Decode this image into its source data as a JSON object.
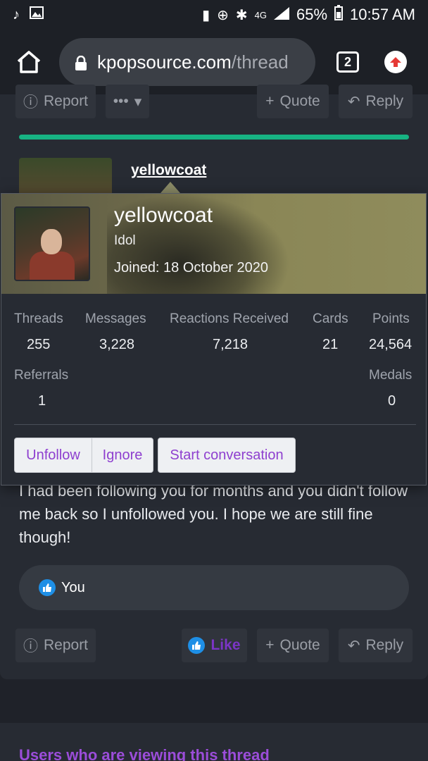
{
  "status_bar": {
    "battery": "65%",
    "time": "10:57 AM",
    "network": "4G"
  },
  "browser": {
    "host": "kpopsource.com",
    "path": "/thread",
    "tab_count": "2"
  },
  "post_actions_top": {
    "report": "Report",
    "more": "•••",
    "quote": "Quote",
    "reply": "Reply"
  },
  "post": {
    "author": "yellowcoat",
    "message": "I had been following you for months and you didn't follow me back so I unfollowed you. I hope we are still fine though!",
    "reaction_user": "You",
    "actions": {
      "report": "Report",
      "like": "Like",
      "quote": "Quote",
      "reply": "Reply"
    }
  },
  "popup": {
    "username": "yellowcoat",
    "user_title": "Idol",
    "joined": "Joined: 18 October 2020",
    "stats": [
      {
        "label": "Threads",
        "value": "255"
      },
      {
        "label": "Messages",
        "value": "3,228"
      },
      {
        "label": "Reactions Received",
        "value": "7,218"
      },
      {
        "label": "Cards",
        "value": "21"
      },
      {
        "label": "Points",
        "value": "24,564"
      },
      {
        "label": "Referrals",
        "value": "1"
      },
      {
        "label": "Medals",
        "value": "0"
      }
    ],
    "buttons": {
      "unfollow": "Unfollow",
      "ignore": "Ignore",
      "start_conversation": "Start conversation"
    }
  },
  "viewing_section": {
    "title": "Users who are viewing this thread"
  },
  "colors": {
    "accent_green": "#17b383",
    "link_purple": "#9b4dd9",
    "like_blue": "#1e8fe6"
  }
}
